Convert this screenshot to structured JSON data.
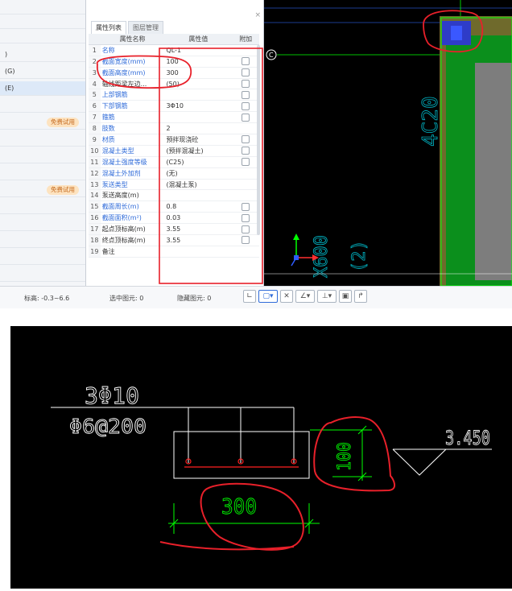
{
  "left_panel": {
    "items": [
      {
        "label": "",
        "badge": ""
      },
      {
        "label": "",
        "badge": ""
      },
      {
        "label": "",
        "badge": ""
      },
      {
        "label": ")",
        "badge": ""
      },
      {
        "label": "(G)",
        "badge": ""
      },
      {
        "label": "(E)",
        "badge": ""
      },
      {
        "label": "",
        "badge": ""
      },
      {
        "label": "",
        "badge": ""
      },
      {
        "label": "",
        "badge": "免费试用"
      },
      {
        "label": "",
        "badge": ""
      },
      {
        "label": "",
        "badge": ""
      },
      {
        "label": "",
        "badge": ""
      },
      {
        "label": "",
        "badge": ""
      },
      {
        "label": "",
        "badge": "免费试用"
      },
      {
        "label": "",
        "badge": ""
      },
      {
        "label": "",
        "badge": ""
      },
      {
        "label": "",
        "badge": ""
      },
      {
        "label": "",
        "badge": ""
      },
      {
        "label": "",
        "badge": ""
      }
    ]
  },
  "prop_panel": {
    "close_label": "×",
    "tabs": [
      "属性列表",
      "图层管理"
    ],
    "headers": {
      "name": "属性名称",
      "value": "属性值",
      "extra": "附加"
    },
    "rows": [
      {
        "num": "1",
        "name": "名称",
        "value": "QL-1",
        "checkbox": false,
        "plain": false
      },
      {
        "num": "2",
        "name": "截面宽度(mm)",
        "value": "100",
        "checkbox": true,
        "plain": false
      },
      {
        "num": "3",
        "name": "截面高度(mm)",
        "value": "300",
        "checkbox": true,
        "plain": false
      },
      {
        "num": "4",
        "name": "轴线距梁左边...",
        "value": "(50)",
        "checkbox": true,
        "plain": true
      },
      {
        "num": "5",
        "name": "上部钢筋",
        "value": "",
        "checkbox": true,
        "plain": false
      },
      {
        "num": "6",
        "name": "下部钢筋",
        "value": "3Φ10",
        "checkbox": true,
        "plain": false
      },
      {
        "num": "7",
        "name": "箍筋",
        "value": "",
        "checkbox": true,
        "plain": false
      },
      {
        "num": "8",
        "name": "肢数",
        "value": "2",
        "checkbox": false,
        "plain": false
      },
      {
        "num": "9",
        "name": "材质",
        "value": "预拌现浇砼",
        "checkbox": true,
        "plain": false
      },
      {
        "num": "10",
        "name": "混凝土类型",
        "value": "(预拌混凝土)",
        "checkbox": true,
        "plain": false
      },
      {
        "num": "11",
        "name": "混凝土强度等级",
        "value": "(C25)",
        "checkbox": true,
        "plain": false
      },
      {
        "num": "12",
        "name": "混凝土外加剂",
        "value": "(无)",
        "checkbox": false,
        "plain": false
      },
      {
        "num": "13",
        "name": "泵送类型",
        "value": "(混凝土泵)",
        "checkbox": false,
        "plain": false
      },
      {
        "num": "14",
        "name": "泵送高度(m)",
        "value": "",
        "checkbox": false,
        "plain": true
      },
      {
        "num": "15",
        "name": "截面周长(m)",
        "value": "0.8",
        "checkbox": true,
        "plain": false
      },
      {
        "num": "16",
        "name": "截面面积(m²)",
        "value": "0.03",
        "checkbox": true,
        "plain": false
      },
      {
        "num": "17",
        "name": "起点顶标高(m)",
        "value": "3.55",
        "checkbox": true,
        "plain": true
      },
      {
        "num": "18",
        "name": "终点顶标高(m)",
        "value": "3.55",
        "checkbox": true,
        "plain": true
      },
      {
        "num": "19",
        "name": "备注",
        "value": "",
        "checkbox": false,
        "plain": true
      }
    ]
  },
  "status_bar": {
    "elevation": "标高: -0.3~6.6",
    "selected": "选中图元: 0",
    "hidden": "隐藏图元: 0"
  },
  "toolbar": {
    "buttons": [
      "∟",
      "▢▾",
      "✕",
      "∠▾",
      "⊥▾",
      "▣",
      "↱"
    ]
  },
  "cad_top": {
    "axis_label": "C",
    "rebar_text": "4C20",
    "dim_text": "X600",
    "dim_text2": "(2)"
  },
  "cad_bottom": {
    "top_rebar": "3Φ10",
    "stirrup": "Φ6@200",
    "height_dim": "100",
    "width_dim": "300",
    "elevation": "3.450"
  },
  "colors": {
    "cad_bg": "#000000",
    "cad_white": "#ffffff",
    "cad_green": "#00ff00",
    "cad_red": "#ff2020",
    "highlight_red": "#e8202a",
    "link_blue": "#2f6bd9"
  }
}
